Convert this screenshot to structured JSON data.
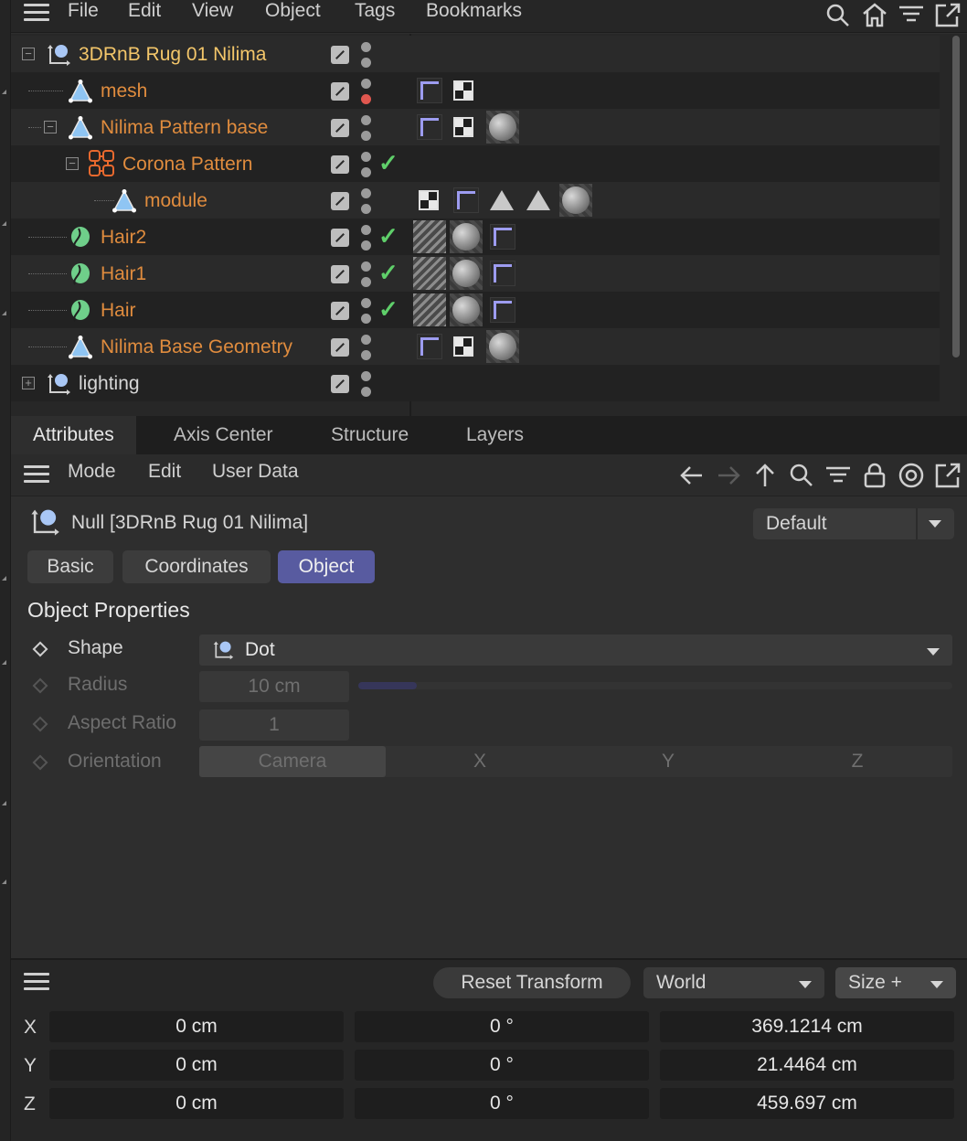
{
  "menu": {
    "items": [
      "File",
      "Edit",
      "View",
      "Object",
      "Tags",
      "Bookmarks"
    ],
    "icons": [
      "search-icon",
      "home-icon",
      "filter-icon",
      "new-window-icon"
    ]
  },
  "objects": [
    {
      "name": "3DRnB Rug 01 Nilima",
      "color": "#f3c66a",
      "icon": "null-icon",
      "expander": "−",
      "dot2": "#9b9b9b",
      "check": false
    },
    {
      "name": "mesh",
      "color": "#e08c3e",
      "icon": "polygon-icon",
      "expander": "",
      "dot2": "#e0574f",
      "check": false
    },
    {
      "name": "Nilima Pattern base",
      "color": "#e08c3e",
      "icon": "polygon-icon",
      "expander": "−",
      "dot2": "#9b9b9b",
      "check": false
    },
    {
      "name": "Corona Pattern",
      "color": "#e08c3e",
      "icon": "corona-pattern-icon",
      "expander": "−",
      "dot2": "#9b9b9b",
      "check": true
    },
    {
      "name": "module",
      "color": "#e08c3e",
      "icon": "polygon-icon",
      "expander": "",
      "dot2": "#9b9b9b",
      "check": false
    },
    {
      "name": "Hair2",
      "color": "#e08c3e",
      "icon": "hair-icon",
      "expander": "",
      "dot2": "#9b9b9b",
      "check": true
    },
    {
      "name": "Hair1",
      "color": "#e08c3e",
      "icon": "hair-icon",
      "expander": "",
      "dot2": "#9b9b9b",
      "check": true
    },
    {
      "name": "Hair",
      "color": "#e08c3e",
      "icon": "hair-icon",
      "expander": "",
      "dot2": "#9b9b9b",
      "check": true
    },
    {
      "name": "Nilima Base Geometry",
      "color": "#e08c3e",
      "icon": "polygon-icon",
      "expander": "",
      "dot2": "#9b9b9b",
      "check": false
    },
    {
      "name": "lighting",
      "color": "#d6d6d6",
      "icon": "null-icon",
      "expander": "+",
      "dot2": "#9b9b9b",
      "check": false
    }
  ],
  "attributes": {
    "tabs": [
      "Attributes",
      "Axis Center",
      "Structure",
      "Layers"
    ],
    "toolbar": {
      "mode": "Mode",
      "edit": "Edit",
      "user_data": "User Data"
    },
    "object_title": "Null [3DRnB Rug 01 Nilima]",
    "preset": "Default",
    "sub_tabs": [
      "Basic",
      "Coordinates",
      "Object"
    ],
    "section_title": "Object Properties",
    "props": {
      "shape_label": "Shape",
      "shape_value": "Dot",
      "radius_label": "Radius",
      "radius_value": "10 cm",
      "aspect_label": "Aspect Ratio",
      "aspect_value": "1",
      "orientation_label": "Orientation",
      "orientation_options": [
        "Camera",
        "X",
        "Y",
        "Z"
      ]
    }
  },
  "coords": {
    "reset": "Reset Transform",
    "space": "World",
    "mode": "Size +",
    "rows": [
      {
        "axis": "X",
        "pos": "0 cm",
        "rot": "0 °",
        "size": "369.1214 cm"
      },
      {
        "axis": "Y",
        "pos": "0 cm",
        "rot": "0 °",
        "size": "21.4464 cm"
      },
      {
        "axis": "Z",
        "pos": "0 cm",
        "rot": "0 °",
        "size": "459.697 cm"
      }
    ]
  },
  "colors": {
    "accent": "#585ba0",
    "active_object": "#f3c66a",
    "object": "#e08c3e",
    "check": "#5fcf6a",
    "dot_red": "#e0574f",
    "phong": "#9d9cf0"
  }
}
